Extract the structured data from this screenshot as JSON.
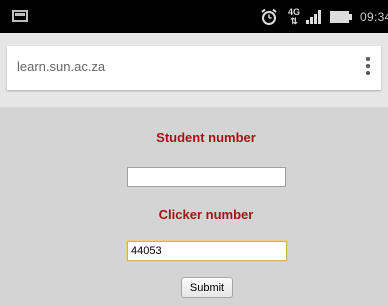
{
  "status_bar": {
    "time": "09:34",
    "network": "4G",
    "icons": [
      "image-thumbnail-icon",
      "alarm-clock-icon",
      "signal-icon",
      "battery-icon"
    ]
  },
  "browser": {
    "url": "learn.sun.ac.za",
    "menu_icon": "more-vertical-icon"
  },
  "form": {
    "student_number": {
      "label": "Student number",
      "value": ""
    },
    "clicker_number": {
      "label": "Clicker number",
      "value": "44053"
    },
    "submit_label": "Submit"
  },
  "colors": {
    "label": "#a31515",
    "page_background": "#d4d4d4",
    "status_bar": "#000000"
  }
}
